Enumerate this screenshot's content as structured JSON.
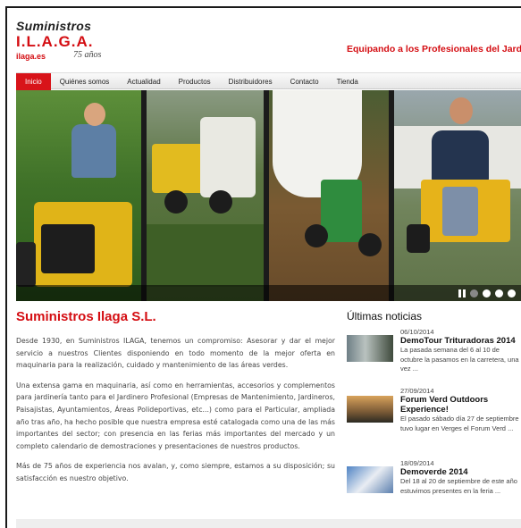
{
  "header": {
    "logo_line1": "Suministros",
    "logo_line2": "I.L.A.G.A.",
    "logo_domain": "ilaga.es",
    "logo_years": "75 años",
    "tagline": "Equipando a los Profesionales del Jardín"
  },
  "nav": {
    "items": [
      {
        "label": "Inicio",
        "active": true
      },
      {
        "label": "Quiénes somos"
      },
      {
        "label": "Actualidad"
      },
      {
        "label": "Productos"
      },
      {
        "label": "Distribuidores"
      },
      {
        "label": "Contacto"
      },
      {
        "label": "Tienda"
      }
    ]
  },
  "slider": {
    "slides_total": 4,
    "active_slide": 2
  },
  "main": {
    "title": "Suministros Ilaga S.L.",
    "paragraphs": [
      "Desde 1930, en Suministros ILAGA, tenemos un compromiso: Asesorar y dar el mejor servicio a nuestros Clientes disponiendo en todo momento de la mejor oferta en maquinaria para la realización, cuidado y mantenimiento de las áreas verdes.",
      "Una extensa gama en maquinaria, así como en herramientas, accesorios y complementos para jardinería tanto para el Jardinero Profesional (Empresas de Mantenimiento, Jardineros, Paisajistas, Ayuntamientos, Áreas Polideportivas, etc...) como para el Particular, ampliada año tras año, ha hecho posible que nuestra empresa esté catalogada como una de las más importantes del sector; con presencia en las ferias más importantes del mercado y un completo calendario de demostraciones y presentaciones de nuestros productos.",
      "Más de 75 años de experiencia nos avalan, y, como siempre, estamos a su disposición; su satisfacción es nuestro objetivo."
    ]
  },
  "news": {
    "title": "Últimas noticias",
    "items": [
      {
        "date": "06/10/2014",
        "headline": "DemoTour Trituradoras 2014",
        "desc": "La pasada semana del 6 al 10 de octubre la pasamos en la carretera, una vez ..."
      },
      {
        "date": "27/09/2014",
        "headline": "Forum Verd Outdoors Experience!",
        "desc": "El pasado sábado día 27 de septiembre tuvo lugar en Verges el Forum Verd ..."
      },
      {
        "date": "18/09/2014",
        "headline": "Demoverde 2014",
        "desc": "Del 18 al 20 de septiembre de este año estuvimos presentes en la feria ..."
      }
    ]
  },
  "colors": {
    "brand_red": "#d40d12",
    "nav_active": "#d8141a"
  }
}
